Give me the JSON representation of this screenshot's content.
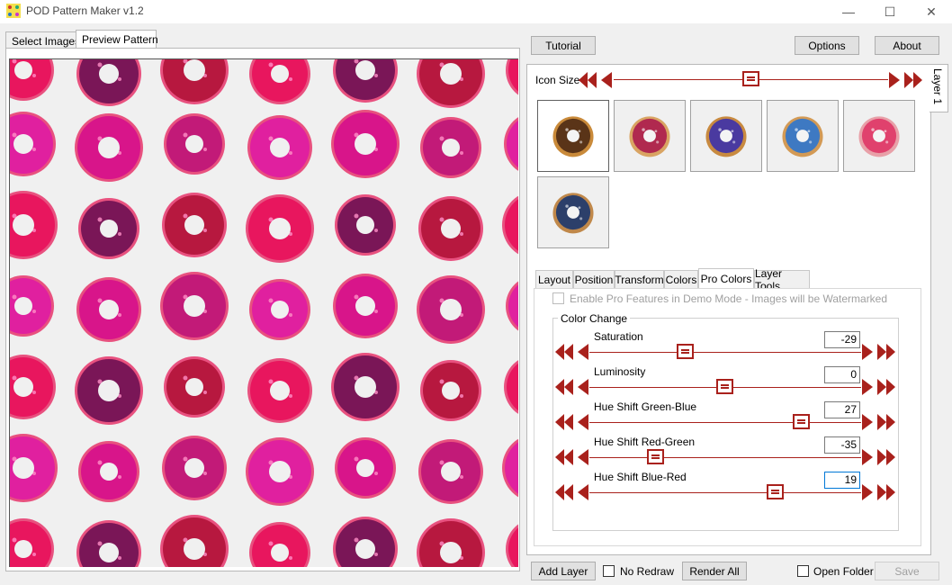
{
  "window": {
    "title": "POD Pattern Maker v1.2",
    "minimize": "—",
    "maximize": "☐",
    "close": "✕"
  },
  "left_tabs": {
    "select_images": "Select Images",
    "preview_pattern": "Preview Pattern"
  },
  "toolbar": {
    "tutorial": "Tutorial",
    "options": "Options",
    "about": "About"
  },
  "layer_tab": "Layer 1",
  "icon_size": {
    "label": "Icon Size",
    "value_fraction": 0.5
  },
  "images": [
    {
      "name": "chocolate-donut",
      "icing": "#5a3418",
      "dough": "#c98a3a",
      "selected": true
    },
    {
      "name": "pink-sprinkle-donut",
      "icing": "#b0294f",
      "dough": "#d9a463",
      "selected": false
    },
    {
      "name": "purple-donut",
      "icing": "#4a3aa0",
      "dough": "#c88a40",
      "selected": false
    },
    {
      "name": "blue-dripping-donut",
      "icing": "#3e79c2",
      "dough": "#d39a55",
      "selected": false
    },
    {
      "name": "pink-glazed-donut",
      "icing": "#e0416d",
      "dough": "#e8a0a8",
      "selected": false
    },
    {
      "name": "navy-galaxy-donut",
      "icing": "#2c3f6a",
      "dough": "#c0884a",
      "selected": false
    }
  ],
  "settings_tabs": [
    "Layout",
    "Position",
    "Transform",
    "Colors",
    "Pro Colors",
    "Layer Tools"
  ],
  "active_settings_tab": "Pro Colors",
  "pro_colors": {
    "demo_checkbox_label": "Enable Pro Features in Demo Mode - Images will be Watermarked",
    "group_title": "Color Change",
    "sliders": [
      {
        "label": "Saturation",
        "value": "-29",
        "fraction": 0.355
      },
      {
        "label": "Luminosity",
        "value": "0",
        "fraction": 0.5
      },
      {
        "label": "Hue Shift Green-Blue",
        "value": "27",
        "fraction": 0.78
      },
      {
        "label": "Hue Shift Red-Green",
        "value": "-35",
        "fraction": 0.245
      },
      {
        "label": "Hue Shift Blue-Red",
        "value": "19",
        "fraction": 0.685
      }
    ]
  },
  "bottom_bar": {
    "add_layer": "Add Layer",
    "no_redraw": "No Redraw",
    "render_all": "Render All",
    "open_folder": "Open Folder",
    "save": "Save"
  },
  "colors": {
    "accent_red": "#a9211c"
  },
  "pattern_palette": [
    "#e8165e",
    "#c21a78",
    "#7a1657",
    "#e0209f",
    "#b7183f",
    "#d8158a"
  ]
}
